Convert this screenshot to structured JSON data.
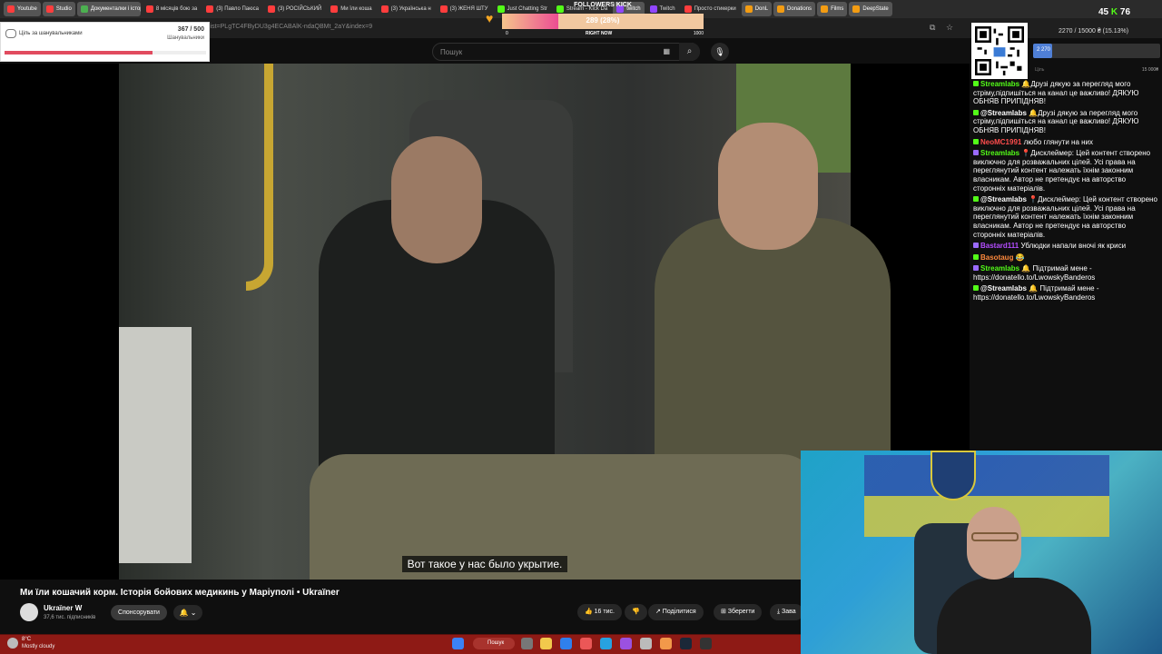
{
  "tabs": [
    {
      "label": "Youtube",
      "bookmark": true,
      "color": "#ff3d3d"
    },
    {
      "label": "Studio",
      "bookmark": true,
      "color": "#ff3d3d"
    },
    {
      "label": "Документалки і історія",
      "bookmark": true,
      "color": "#4caf50"
    },
    {
      "label": "8 місяців бою за",
      "bookmark": false,
      "color": "#ff3d3d"
    },
    {
      "label": "(3) Павло Паюса",
      "bookmark": false,
      "color": "#ff3d3d"
    },
    {
      "label": "(3) РОСІЙСЬКИЙ",
      "bookmark": false,
      "color": "#ff3d3d"
    },
    {
      "label": "Ми їли коша",
      "bookmark": false,
      "color": "#ff3d3d"
    },
    {
      "label": "(3) Українська н",
      "bookmark": false,
      "color": "#ff3d3d"
    },
    {
      "label": "(3) ЖЕНЯ ШТУ",
      "bookmark": false,
      "color": "#ff3d3d"
    },
    {
      "label": "Just Chatting Str",
      "bookmark": false,
      "color": "#53fc18"
    },
    {
      "label": "Stream - Kick Da",
      "bookmark": false,
      "color": "#53fc18"
    },
    {
      "label": "twitch",
      "bookmark": true,
      "color": "#9146ff"
    },
    {
      "label": "Twitch",
      "bookmark": false,
      "color": "#9146ff"
    },
    {
      "label": "Просто стикерки",
      "bookmark": false,
      "color": "#ff3d3d"
    },
    {
      "label": "DonL",
      "bookmark": true,
      "color": "#f39c12"
    },
    {
      "label": "Donations",
      "bookmark": true,
      "color": "#f39c12"
    },
    {
      "label": "Films",
      "bookmark": true,
      "color": "#f39c12"
    },
    {
      "label": "DeepState",
      "bookmark": true,
      "color": "#f39c12"
    }
  ],
  "address": {
    "url": "list=PLgTC4FByDU3g4ECABAlK-ndaQBMt_2aY&index=9"
  },
  "search": {
    "placeholder": "Пошук",
    "keyboard": "▦",
    "button": "⌕",
    "mic": "🎙"
  },
  "video": {
    "subtitle": "Вот такое у нас было укрытие.",
    "title": "Ми їли кошачий корм. Історія бойових медикинь у Маріуполі • Ukraїner",
    "channel": "Ukraїner W",
    "subscribers": "37,6 тис. підписників",
    "sponsor": "Спонсорувати",
    "bell": "🔔 ⌄",
    "likes": "👍 16 тис.",
    "dislike": "👎",
    "share": "↗ Поділитися",
    "save": "⊞ Зберегти",
    "download": "⤓ Зава"
  },
  "goal_widget": {
    "title": "Ціль за шанувальниками",
    "value": "367 / 500",
    "unit": "Шанувальники",
    "progress": 0.734
  },
  "followers_kick": {
    "label": "FOLLOWERS KICK",
    "count": "289 (28%)",
    "progress": 0.28,
    "min": "0",
    "mid": "RIGHT NOW",
    "max": "1000"
  },
  "kick_counter": {
    "viewers": "45",
    "k": "K",
    "followers": "76"
  },
  "donation_goal": {
    "text": "2270 / 15000 ₴ (15.13%)",
    "current": "2 270",
    "min": "Ціль",
    "max": "15 000₴",
    "progress": 0.1513
  },
  "chat": [
    {
      "user": "Streamlabs",
      "user_color": "#53fc18",
      "text": "🔔Друзі дякую за перегляд мого стріму,підпишіться на канал це важливо! ДЯКУЮ ОБНЯВ ПРИПІДНЯВ!",
      "badge": "kick"
    },
    {
      "user": "@Streamlabs",
      "user_color": "#ffffff",
      "text": "🔔Друзі дякую за перегляд мого стріму,підпишіться на канал це важливо! ДЯКУЮ ОБНЯВ ПРИПІДНЯВ!",
      "badge": "kick"
    },
    {
      "user": "NeoMC1991",
      "user_color": "#ff4d4d",
      "text": "любо глянути на них",
      "badge": "kick"
    },
    {
      "user": "Streamlabs",
      "user_color": "#53fc18",
      "text": "📍Дисклеймер: Цей контент створено виключно для розважальних цілей. Усі права на переглянутий контент належать їхнім законним власникам. Автор не претендує на авторство сторонніх матеріалів.",
      "badge": "twitch"
    },
    {
      "user": "@Streamlabs",
      "user_color": "#ffffff",
      "text": "📍Дисклеймер: Цей контент створено виключно для розважальних цілей. Усі права на переглянутий контент належать їхнім законним власникам. Автор не претендує на авторство сторонніх матеріалів.",
      "badge": "kick"
    },
    {
      "user": "Bastard111",
      "user_color": "#b44dff",
      "text": "Ублюдки напали вночі як криси",
      "badge": "twitch"
    },
    {
      "user": "Basotaug",
      "user_color": "#ff8a3d",
      "text": "😂",
      "badge": "kick"
    },
    {
      "user": "Streamlabs",
      "user_color": "#53fc18",
      "text": "🔔 Підтримай мене - https://donatello.to/LwowskyBanderos",
      "badge": "twitch"
    },
    {
      "user": "@Streamlabs",
      "user_color": "#ffffff",
      "text": "🔔 Підтримай мене - https://donatello.to/LwowskyBanderos",
      "badge": "kick"
    }
  ],
  "taskbar": {
    "temp": "8°C",
    "weather": "Mostly cloudy",
    "search": "Пошук"
  },
  "colors": {
    "taskbar": "#8e1a15",
    "kick_green": "#53fc18",
    "accent_red": "#e14b5f"
  }
}
